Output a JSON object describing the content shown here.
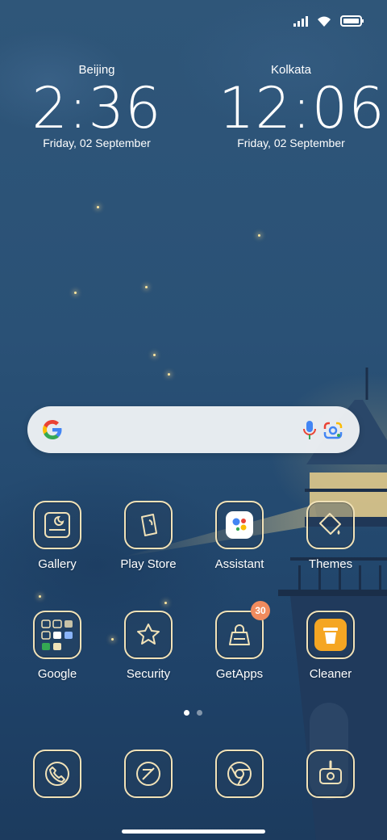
{
  "clocks": [
    {
      "city": "Beijing",
      "time": "2:36",
      "date": "Friday, 02 September"
    },
    {
      "city": "Kolkata",
      "time": "12:06",
      "date": "Friday, 02 September"
    }
  ],
  "status_icons": [
    "signal-icon",
    "wifi-icon",
    "battery-icon"
  ],
  "apps_row1": [
    {
      "label": "Gallery",
      "icon": "gallery-icon"
    },
    {
      "label": "Play Store",
      "icon": "play-store-icon"
    },
    {
      "label": "Assistant",
      "icon": "assistant-icon"
    },
    {
      "label": "Themes",
      "icon": "themes-icon"
    }
  ],
  "apps_row2": [
    {
      "label": "Google",
      "icon": "google-folder-icon"
    },
    {
      "label": "Security",
      "icon": "security-icon"
    },
    {
      "label": "GetApps",
      "icon": "getapps-icon",
      "badge": "30"
    },
    {
      "label": "Cleaner",
      "icon": "cleaner-icon"
    }
  ],
  "dock": [
    {
      "icon": "phone-icon"
    },
    {
      "icon": "messages-icon"
    },
    {
      "icon": "chrome-icon"
    },
    {
      "icon": "camera-icon"
    }
  ],
  "page_indicator": {
    "count": 2,
    "active": 0
  },
  "colors": {
    "icon_outline": "#f1e2b8",
    "badge": "#f18b5e",
    "cleaner": "#f5a623"
  }
}
